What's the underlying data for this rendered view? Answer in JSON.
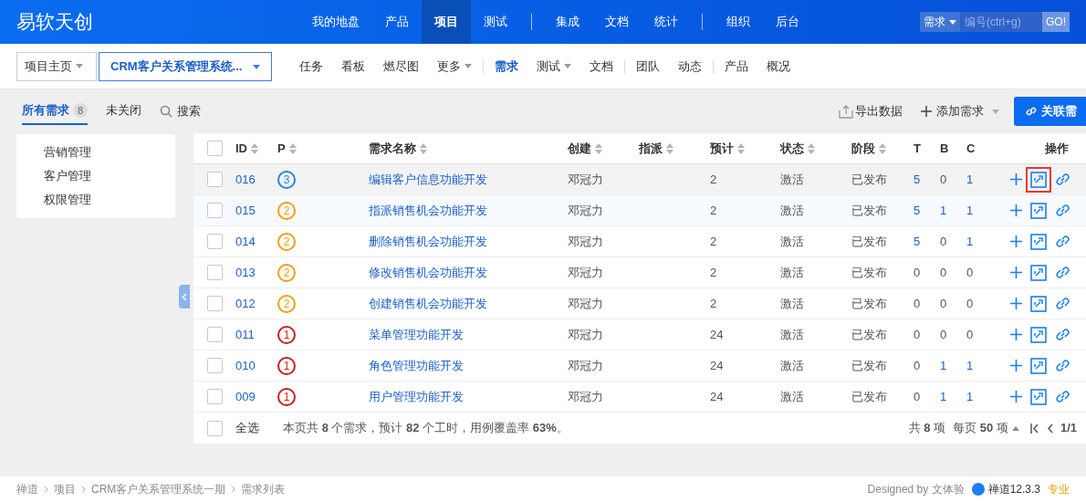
{
  "brand": "易软天创",
  "top_nav": [
    {
      "kind": "link",
      "label": "我的地盘",
      "selected": false
    },
    {
      "kind": "link",
      "label": "产品",
      "selected": false
    },
    {
      "kind": "link",
      "label": "项目",
      "selected": true
    },
    {
      "kind": "link",
      "label": "测试",
      "selected": false
    },
    {
      "kind": "separator"
    },
    {
      "kind": "link",
      "label": "集成",
      "selected": false
    },
    {
      "kind": "link",
      "label": "文档",
      "selected": false
    },
    {
      "kind": "link",
      "label": "统计",
      "selected": false
    },
    {
      "kind": "separator"
    },
    {
      "kind": "link",
      "label": "组织",
      "selected": false
    },
    {
      "kind": "link",
      "label": "后台",
      "selected": false
    }
  ],
  "search": {
    "type": "需求",
    "placeholder": "编号(ctrl+g)",
    "go": "GO!"
  },
  "crumbs": {
    "home": "项目主页",
    "project": "CRM客户关系管理系统..."
  },
  "sub_nav": [
    {
      "kind": "link",
      "label": "任务",
      "selected": false,
      "caret": false
    },
    {
      "kind": "link",
      "label": "看板",
      "selected": false,
      "caret": false
    },
    {
      "kind": "link",
      "label": "燃尽图",
      "selected": false,
      "caret": false
    },
    {
      "kind": "link",
      "label": "更多",
      "selected": false,
      "caret": true
    },
    {
      "kind": "separator"
    },
    {
      "kind": "link",
      "label": "需求",
      "selected": true,
      "caret": false
    },
    {
      "kind": "link",
      "label": "测试",
      "selected": false,
      "caret": true
    },
    {
      "kind": "link",
      "label": "文档",
      "selected": false,
      "caret": false
    },
    {
      "kind": "separator"
    },
    {
      "kind": "link",
      "label": "团队",
      "selected": false,
      "caret": false
    },
    {
      "kind": "link",
      "label": "动态",
      "selected": false,
      "caret": false
    },
    {
      "kind": "separator"
    },
    {
      "kind": "link",
      "label": "产品",
      "selected": false,
      "caret": false
    },
    {
      "kind": "link",
      "label": "概况",
      "selected": false,
      "caret": false
    }
  ],
  "filters": [
    {
      "label": "所有需求",
      "count": "8",
      "selected": true
    },
    {
      "label": "未关闭",
      "selected": false
    }
  ],
  "search_link": "搜索",
  "actions": {
    "export": "导出数据",
    "add": "添加需求",
    "link": "关联需"
  },
  "modules": [
    "营销管理",
    "客户管理",
    "权限管理"
  ],
  "header_checked": false,
  "columns": [
    {
      "label": "ID",
      "sortable": true
    },
    {
      "label": "P",
      "sortable": true
    },
    {
      "label": "需求名称",
      "sortable": true
    },
    {
      "label": "创建",
      "sortable": true
    },
    {
      "label": "指派",
      "sortable": true
    },
    {
      "label": "预计",
      "sortable": true
    },
    {
      "label": "状态",
      "sortable": true
    },
    {
      "label": "阶段",
      "sortable": true
    },
    {
      "label": "T",
      "sortable": false
    },
    {
      "label": "B",
      "sortable": false
    },
    {
      "label": "C",
      "sortable": false
    },
    {
      "label": "操作",
      "sortable": false
    }
  ],
  "rows": [
    {
      "checked": false,
      "id": "016",
      "pri": "3",
      "name": "编辑客户信息功能开发",
      "creator": "邓冠力",
      "estimate": "2",
      "status": "激活",
      "stage": "已发布",
      "t": "5",
      "b": "0",
      "c": "1",
      "hovered": true,
      "annotated": true
    },
    {
      "checked": false,
      "id": "015",
      "pri": "2",
      "name": "指派销售机会功能开发",
      "creator": "邓冠力",
      "estimate": "2",
      "status": "激活",
      "stage": "已发布",
      "t": "5",
      "b": "1",
      "c": "1",
      "hovered": false,
      "annotated": false
    },
    {
      "checked": false,
      "id": "014",
      "pri": "2",
      "name": "删除销售机会功能开发",
      "creator": "邓冠力",
      "estimate": "2",
      "status": "激活",
      "stage": "已发布",
      "t": "5",
      "b": "0",
      "c": "1",
      "hovered": false,
      "annotated": false
    },
    {
      "checked": false,
      "id": "013",
      "pri": "2",
      "name": "修改销售机会功能开发",
      "creator": "邓冠力",
      "estimate": "2",
      "status": "激活",
      "stage": "已发布",
      "t": "0",
      "b": "0",
      "c": "0",
      "hovered": false,
      "annotated": false
    },
    {
      "checked": false,
      "id": "012",
      "pri": "2",
      "name": "创建销售机会功能开发",
      "creator": "邓冠力",
      "estimate": "2",
      "status": "激活",
      "stage": "已发布",
      "t": "0",
      "b": "0",
      "c": "0",
      "hovered": false,
      "annotated": false
    },
    {
      "checked": false,
      "id": "011",
      "pri": "1",
      "name": "菜单管理功能开发",
      "creator": "邓冠力",
      "estimate": "24",
      "status": "激活",
      "stage": "已发布",
      "t": "0",
      "b": "0",
      "c": "0",
      "hovered": false,
      "annotated": false
    },
    {
      "checked": false,
      "id": "010",
      "pri": "1",
      "name": "角色管理功能开发",
      "creator": "邓冠力",
      "estimate": "24",
      "status": "激活",
      "stage": "已发布",
      "t": "0",
      "b": "1",
      "c": "1",
      "hovered": false,
      "annotated": false
    },
    {
      "checked": false,
      "id": "009",
      "pri": "1",
      "name": "用户管理功能开发",
      "creator": "邓冠力",
      "estimate": "24",
      "status": "激活",
      "stage": "已发布",
      "t": "0",
      "b": "1",
      "c": "1",
      "hovered": false,
      "annotated": false
    }
  ],
  "footer": {
    "checked": false,
    "select_all": "全选",
    "summary": "本页共 **8** 个需求，预计 **82** 个工时，用例覆盖率 **63%**。",
    "total": "共 **8** 项",
    "per_page": "每页 **50** 项",
    "page": "1/1"
  },
  "bottom": {
    "breadcrumb": [
      "禅道",
      "项目",
      "CRM客户关系管理系统一期",
      "需求列表"
    ],
    "designed": "Designed by 文体验",
    "version": "禅道12.3.3",
    "edition": "专业"
  }
}
